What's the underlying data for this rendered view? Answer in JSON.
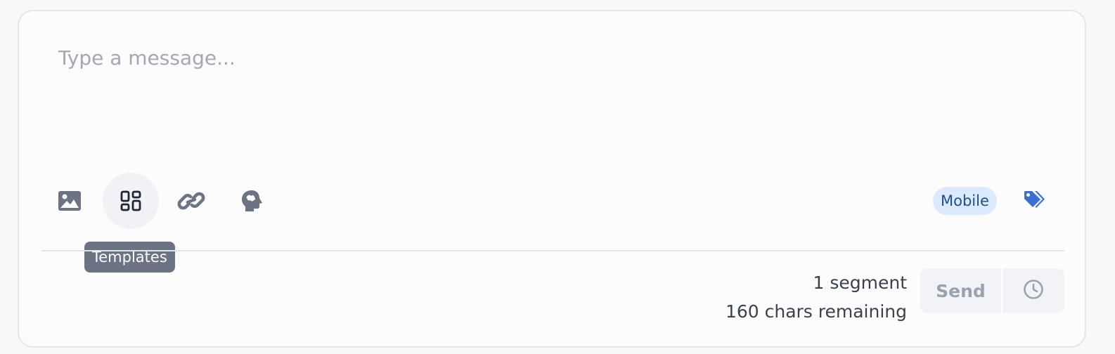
{
  "composer": {
    "placeholder": "Type a message..."
  },
  "toolbar": {
    "tools": [
      {
        "name": "image-icon",
        "label": "Image"
      },
      {
        "name": "templates-icon",
        "label": "Templates",
        "active": true
      },
      {
        "name": "link-icon",
        "label": "Link"
      },
      {
        "name": "ai-brain-icon",
        "label": "AI"
      }
    ],
    "tooltip": "Templates"
  },
  "channel": {
    "badge": "Mobile",
    "tag_icon": "tags-icon"
  },
  "footer": {
    "segments": "1 segment",
    "remaining": "160 chars remaining",
    "send_label": "Send",
    "schedule_icon": "clock-icon"
  },
  "colors": {
    "accent": "#3b6fd4",
    "badge_bg": "#dbeafe",
    "badge_text": "#1e4f8f",
    "icon": "#6b7385",
    "tooltip_bg": "#6b7385"
  }
}
